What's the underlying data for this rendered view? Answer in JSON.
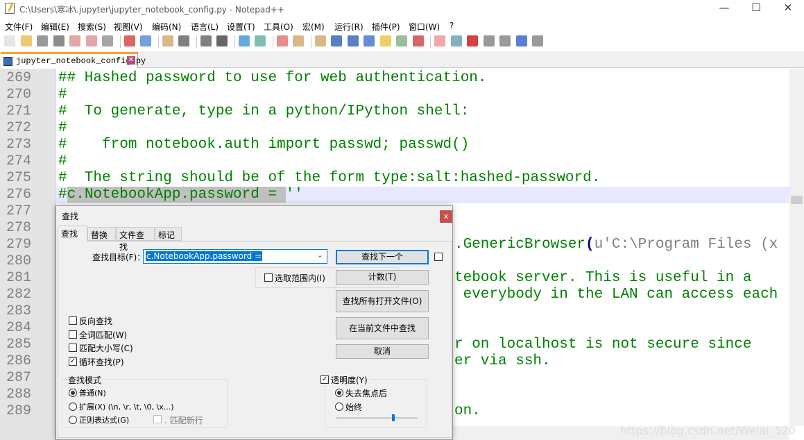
{
  "window": {
    "title": "C:\\Users\\寒冰\\.jupyter\\jupyter_notebook_config.py - Notepad++",
    "close_doc": "X"
  },
  "menu": [
    "文件(F)",
    "编辑(E)",
    "搜索(S)",
    "视图(V)",
    "编码(N)",
    "语言(L)",
    "设置(T)",
    "工具(O)",
    "宏(M)",
    "运行(R)",
    "插件(P)",
    "窗口(W)",
    "?"
  ],
  "toolbar": [
    "new",
    "open",
    "save",
    "save-all",
    "close",
    "close-all",
    "print",
    "cut",
    "copy",
    "paste",
    "undo",
    "redo",
    "find",
    "replace",
    "zoom-in",
    "zoom-out",
    "sync-v",
    "sync-h",
    "wrap",
    "show-all",
    "indent-guide",
    "udl",
    "doc-map",
    "function-list",
    "folder-workspace",
    "monitor",
    "record",
    "stop",
    "play",
    "play-multi",
    "save-macro"
  ],
  "tab": {
    "label": "jupyter_notebook_config.py"
  },
  "editor": {
    "lines": [
      {
        "n": "269",
        "text": "## Hashed password to use for web authentication."
      },
      {
        "n": "270",
        "text": "#"
      },
      {
        "n": "271",
        "text": "#  To generate, type in a python/IPython shell:"
      },
      {
        "n": "272",
        "text": "#"
      },
      {
        "n": "273",
        "text": "#    from notebook.auth import passwd; passwd()"
      },
      {
        "n": "274",
        "text": "#"
      },
      {
        "n": "275",
        "text": "#  The string should be of the form type:salt:hashed-password."
      },
      {
        "n": "276",
        "hash": "#",
        "selected": "c.NotebookApp.password = ",
        "rest": "''"
      },
      {
        "n": "277",
        "text": ""
      },
      {
        "n": "278",
        "text": ""
      },
      {
        "n": "279",
        "text": ".GenericBrowser",
        "paren": "(",
        "string": "u'C:\\Program Files (x"
      },
      {
        "n": "280",
        "text": ""
      },
      {
        "n": "281",
        "text": "tebook server. This is useful in a"
      },
      {
        "n": "282",
        "text": " everybody in the LAN can access each"
      },
      {
        "n": "283",
        "text": ""
      },
      {
        "n": "284",
        "text": ""
      },
      {
        "n": "285",
        "text": "r on localhost is not secure since"
      },
      {
        "n": "286",
        "text": "er via ssh."
      },
      {
        "n": "287",
        "text": ""
      },
      {
        "n": "288",
        "text": ""
      },
      {
        "n": "289",
        "text": "on."
      }
    ],
    "watermark": "https://blog.csdn.net/Weiai_520"
  },
  "dialog": {
    "title": "查找",
    "close": "x",
    "tabs": [
      "查找",
      "替换",
      "文件查找",
      "标记"
    ],
    "find_label": "查找目标(F)：",
    "find_value": "c.NotebookApp.password =",
    "buttons": {
      "find_next": "查找下一个",
      "count": "计数(T)",
      "find_all_open": "查找所有打开文件(O)",
      "find_in_current": "在当前文件中查找",
      "cancel": "取消"
    },
    "in_selection": "选取范围内(I)",
    "options": [
      {
        "label": "反向查找",
        "checked": false
      },
      {
        "label": "全词匹配(W)",
        "checked": false
      },
      {
        "label": "匹配大小写(C)",
        "checked": false
      },
      {
        "label": "循环查找(P)",
        "checked": true
      }
    ],
    "mode": {
      "title": "查找模式",
      "options": [
        "普通(N)",
        "扩展(X) (\\n, \\r, \\t, \\0, \\x...)",
        "正则表达式(G)"
      ],
      "selected": 0,
      "newline": ". 匹配新行"
    },
    "transparency": {
      "label": "透明度(Y)",
      "checked": true,
      "options": [
        "失去焦点后",
        "始终"
      ],
      "selected": 0,
      "level": 0.7
    }
  }
}
